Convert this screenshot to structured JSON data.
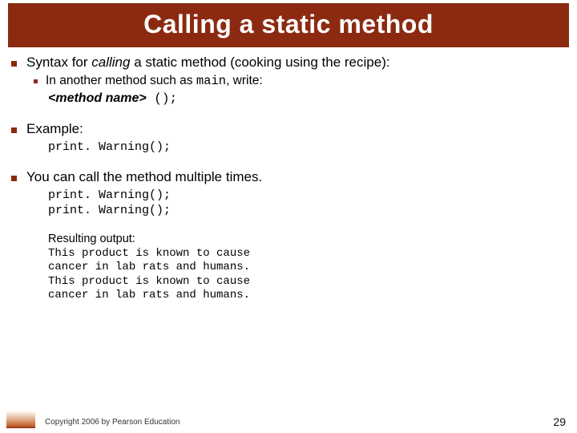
{
  "title": "Calling a static method",
  "b1": {
    "text_a": "Syntax for ",
    "text_b": "calling",
    "text_c": " a static method (cooking using the recipe):",
    "sub_a": "In another method such as ",
    "sub_code": "main",
    "sub_b": ", write:",
    "syntax_name": "<method name>",
    "syntax_call": " ();"
  },
  "b2": {
    "label": "Example:",
    "code": "print. Warning();"
  },
  "b3": {
    "label": "You can call the method multiple times.",
    "code": "print. Warning();\nprint. Warning();"
  },
  "result": {
    "label": "Resulting output:",
    "text": "This product is known to cause\ncancer in lab rats and humans.\nThis product is known to cause\ncancer in lab rats and humans."
  },
  "footer": {
    "copyright": "Copyright 2006 by Pearson Education",
    "page": "29"
  }
}
